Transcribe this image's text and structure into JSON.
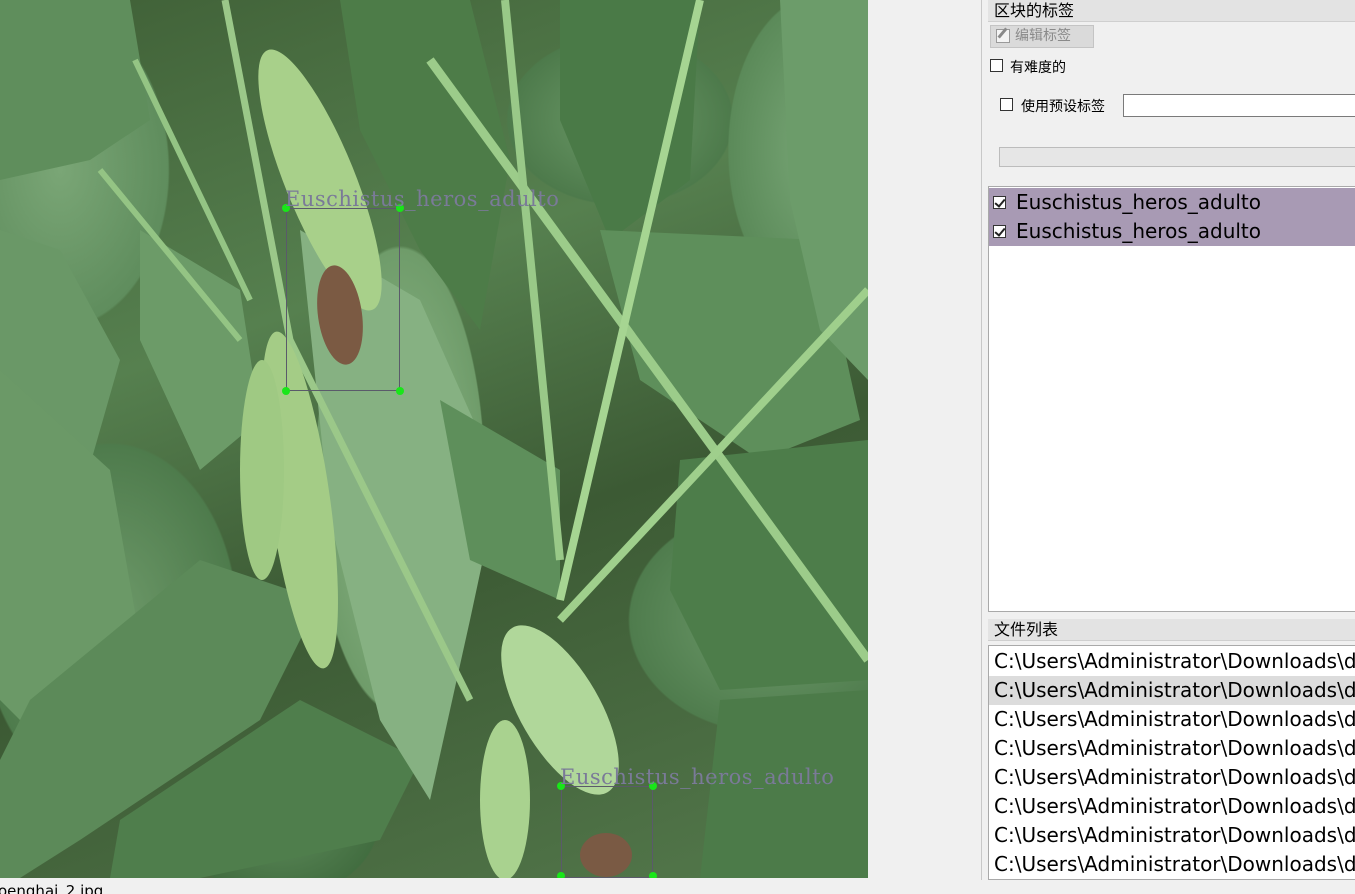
{
  "canvas": {
    "image_description_icon": "soybean-leaves-photo",
    "annotations": [
      {
        "label": "Euschistus_heros_adulto"
      },
      {
        "label": "Euschistus_heros_adulto"
      }
    ]
  },
  "block_labels_panel": {
    "title": "区块的标签",
    "edit_label_button": "编辑标签",
    "difficult_checkbox": "有难度的",
    "use_default_label_checkbox": "使用预设标签",
    "default_label_value": ""
  },
  "label_list": [
    {
      "text": "Euschistus_heros_adulto",
      "checked": true
    },
    {
      "text": "Euschistus_heros_adulto",
      "checked": true
    }
  ],
  "file_list_panel": {
    "title": "文件列表",
    "files": [
      "C:\\Users\\Administrator\\Downloads\\da",
      "C:\\Users\\Administrator\\Downloads\\da",
      "C:\\Users\\Administrator\\Downloads\\da",
      "C:\\Users\\Administrator\\Downloads\\da",
      "C:\\Users\\Administrator\\Downloads\\da",
      "C:\\Users\\Administrator\\Downloads\\da",
      "C:\\Users\\Administrator\\Downloads\\da",
      "C:\\Users\\Administrator\\Downloads\\da"
    ],
    "selected_index": 1
  },
  "status_bar": {
    "text": "oenghai_2.jpg"
  },
  "colors": {
    "handle": "#19e619",
    "label_selected_bg": "#a89ab4",
    "bbox_label_text": "#7a7a98"
  }
}
